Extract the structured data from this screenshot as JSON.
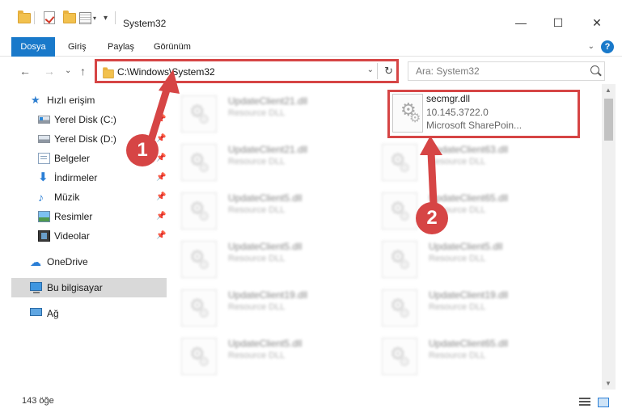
{
  "window": {
    "title": "System32",
    "minimize": "—",
    "maximize": "☐",
    "close": "✕"
  },
  "ribbon": {
    "tabs": [
      "Dosya",
      "Giriş",
      "Paylaş",
      "Görünüm"
    ],
    "help": "?"
  },
  "address": {
    "path": "C:\\Windows\\System32",
    "refresh_glyph": "↻",
    "drop_glyph": "⌄"
  },
  "search": {
    "placeholder": "Ara: System32"
  },
  "nav": {
    "back": "←",
    "forward": "→",
    "recent": "⌄",
    "up": "↑",
    "items": [
      {
        "label": "Hızlı erişim",
        "icon": "star-icon"
      },
      {
        "label": "Yerel Disk (C:)",
        "icon": "drive-icon"
      },
      {
        "label": "Yerel Disk (D:)",
        "icon": "drive-icon"
      },
      {
        "label": "Belgeler",
        "icon": "documents-icon"
      },
      {
        "label": "İndirmeler",
        "icon": "downloads-icon"
      },
      {
        "label": "Müzik",
        "icon": "music-icon"
      },
      {
        "label": "Resimler",
        "icon": "pictures-icon"
      },
      {
        "label": "Videolar",
        "icon": "videos-icon"
      },
      {
        "label": "OneDrive",
        "icon": "cloud-icon"
      },
      {
        "label": "Bu bilgisayar",
        "icon": "computer-icon"
      },
      {
        "label": "Ağ",
        "icon": "network-icon"
      }
    ]
  },
  "files": {
    "highlighted": {
      "name": "secmgr.dll",
      "version": "10.145.3722.0",
      "description": "Microsoft SharePoin..."
    },
    "left_column": [
      {
        "name": "UpdateClient21.dll",
        "type": "Resource DLL"
      },
      {
        "name": "UpdateClient21.dll",
        "type": "Resource DLL"
      },
      {
        "name": "UpdateClient5.dll",
        "type": "Resource DLL"
      },
      {
        "name": "UpdateClient5.dll",
        "type": "Resource DLL"
      },
      {
        "name": "UpdateClient19.dll",
        "type": "Resource DLL"
      },
      {
        "name": "UpdateClient5.dll",
        "type": "Resource DLL"
      }
    ],
    "right_column": [
      {
        "name": "UpdateClient63.dll",
        "type": "Resource DLL"
      },
      {
        "name": "UpdateClient65.dll",
        "type": "Resource DLL"
      },
      {
        "name": "UpdateClient5.dll",
        "type": "Resource DLL"
      },
      {
        "name": "UpdateClient19.dll",
        "type": "Resource DLL"
      },
      {
        "name": "UpdateClient65.dll",
        "type": "Resource DLL"
      }
    ]
  },
  "status": {
    "count": "143 öğe"
  },
  "annotations": {
    "step1": "1",
    "step2": "2",
    "color": "#d64545"
  }
}
